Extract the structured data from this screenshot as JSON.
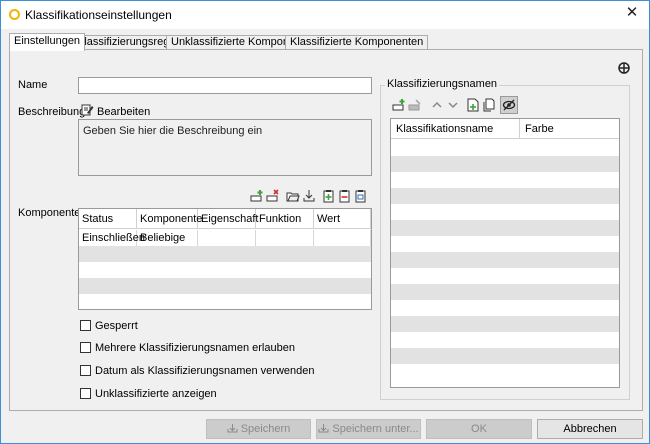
{
  "window": {
    "title": "Klassifikationseinstellungen",
    "close_glyph": "✕"
  },
  "tabs": [
    {
      "label": "Einstellungen",
      "active": true
    },
    {
      "label": "Klassifizierungsregeln",
      "active": false
    },
    {
      "label": "Unklassifizierte Komponenten",
      "active": false
    },
    {
      "label": "Klassifizierte Komponenten",
      "active": false
    }
  ],
  "form": {
    "name_label": "Name",
    "name_value": "",
    "description_label": "Beschreibung",
    "edit_label": "Bearbeiten",
    "description_text": "Geben Sie hier die Beschreibung ein",
    "components_label": "Komponenten"
  },
  "components_table": {
    "columns": [
      "Status",
      "Komponente",
      "Eigenschaft",
      "Funktion",
      "Wert"
    ],
    "rows": [
      [
        "Einschließen",
        "Beliebige",
        "",
        "",
        ""
      ]
    ]
  },
  "options": [
    {
      "label": "Gesperrt",
      "checked": false
    },
    {
      "label": "Mehrere Klassifizierungsnamen erlauben",
      "checked": false
    },
    {
      "label": "Datum als Klassifizierungsnamen verwenden",
      "checked": false
    },
    {
      "label": "Unklassifizierte anzeigen",
      "checked": false
    }
  ],
  "classification": {
    "group_label": "Klassifizierungsnamen",
    "columns": [
      "Klassifikationsname",
      "Farbe"
    ],
    "rows": []
  },
  "buttons": {
    "save": "Speichern",
    "save_as": "Speichern unter...",
    "ok": "OK",
    "cancel": "Abbrechen"
  },
  "colors": {
    "accent_green": "#3aa53a",
    "accent_red": "#d32f2f",
    "row_alt": "#e2e2e2"
  }
}
